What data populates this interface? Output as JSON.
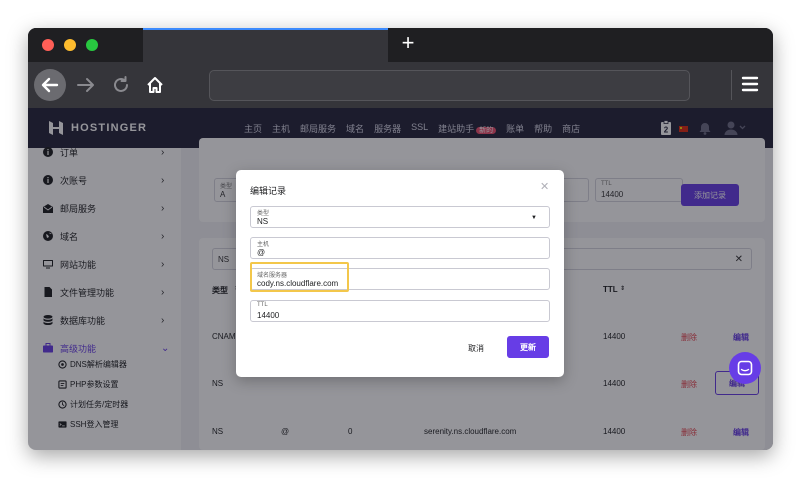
{
  "browser": {
    "new_tab_glyph": "+",
    "back_icon": "arrow-left-icon",
    "forward_icon": "arrow-right-icon",
    "reload_icon": "reload-icon",
    "home_icon": "home-icon",
    "menu_icon": "hamburger-menu-icon",
    "url_value": ""
  },
  "header": {
    "brand": "HOSTINGER",
    "nav": [
      "主页",
      "主机",
      "邮局服务",
      "域名",
      "服务器",
      "SSL",
      "建站助手",
      "账单",
      "帮助",
      "商店"
    ],
    "new_badge": "新的"
  },
  "sidebar": {
    "items": [
      {
        "label": "订单",
        "icon": "info-icon"
      },
      {
        "label": "次账号",
        "icon": "info-icon"
      },
      {
        "label": "邮局服务",
        "icon": "mail-icon"
      },
      {
        "label": "域名",
        "icon": "globe-icon"
      },
      {
        "label": "网站功能",
        "icon": "monitor-icon"
      },
      {
        "label": "文件管理功能",
        "icon": "file-icon"
      },
      {
        "label": "数据库功能",
        "icon": "database-icon"
      },
      {
        "label": "高级功能",
        "icon": "briefcase-icon"
      }
    ],
    "subitems": [
      {
        "label": "DNS解析编辑器",
        "icon": "dns-icon"
      },
      {
        "label": "PHP参数设置",
        "icon": "php-icon"
      },
      {
        "label": "计划任务/定时器",
        "icon": "clock-icon"
      },
      {
        "label": "SSH登入管理",
        "icon": "terminal-icon"
      }
    ]
  },
  "form": {
    "type_label": "类型",
    "type_value": "A",
    "host_label": "主机",
    "points_label": "指向",
    "ttl_label": "TTL",
    "ttl_value": "14400",
    "add_button": "添加记录"
  },
  "filter": {
    "value": "NS"
  },
  "table": {
    "headers": {
      "type": "类型",
      "ttl": "TTL"
    },
    "rows": [
      {
        "type": "CNAME",
        "ttl": "14400",
        "delete": "删除",
        "edit": "编辑"
      },
      {
        "type": "NS",
        "ttl": "14400",
        "delete": "删除",
        "edit": "编辑"
      },
      {
        "type": "NS",
        "host": "@",
        "priority": "0",
        "points": "serenity.ns.cloudflare.com",
        "ttl": "14400",
        "delete": "删除",
        "edit": "编辑"
      }
    ]
  },
  "modal": {
    "title": "编辑记录",
    "fields": {
      "type_label": "类型",
      "type_value": "NS",
      "host_label": "主机",
      "host_value": "@",
      "ns_label": "域名服务器",
      "ns_value": "cody.ns.cloudflare.com",
      "ttl_label": "TTL",
      "ttl_value": "14400"
    },
    "cancel": "取消",
    "update": "更新"
  },
  "colors": {
    "brand_purple": "#673de6",
    "nav_dark": "#24243a",
    "danger": "#e63f4a",
    "highlight": "#f3c74b"
  }
}
